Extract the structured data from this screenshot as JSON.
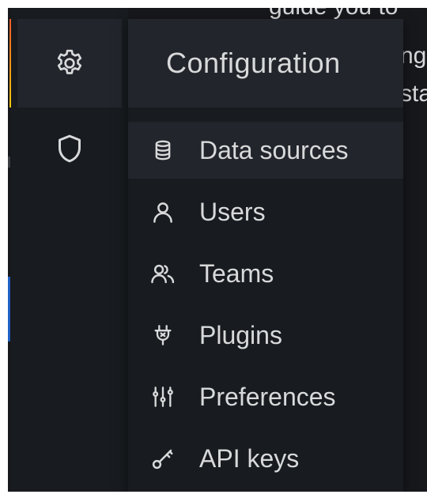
{
  "background": {
    "line_1": "guide you to",
    "line_2": "ng",
    "line_3": "sta"
  },
  "sidebar": {
    "items": [
      {
        "icon": "gear-icon",
        "active": true
      },
      {
        "icon": "shield-icon",
        "active": false
      }
    ]
  },
  "menu": {
    "title": "Configuration",
    "items": [
      {
        "label": "Data sources",
        "icon": "database-icon",
        "active": true
      },
      {
        "label": "Users",
        "icon": "user-icon",
        "active": false
      },
      {
        "label": "Teams",
        "icon": "users-icon",
        "active": false
      },
      {
        "label": "Plugins",
        "icon": "plug-icon",
        "active": false
      },
      {
        "label": "Preferences",
        "icon": "sliders-icon",
        "active": false
      },
      {
        "label": "API keys",
        "icon": "key-icon",
        "active": false
      }
    ]
  },
  "colors": {
    "background": "#17181c",
    "panel": "#181b1f",
    "active": "#22252b",
    "text": "#d8d9da",
    "accent_orange": "#f05a28",
    "accent_yellow": "#fbca0a",
    "accent_blue": "#1f60c4"
  }
}
